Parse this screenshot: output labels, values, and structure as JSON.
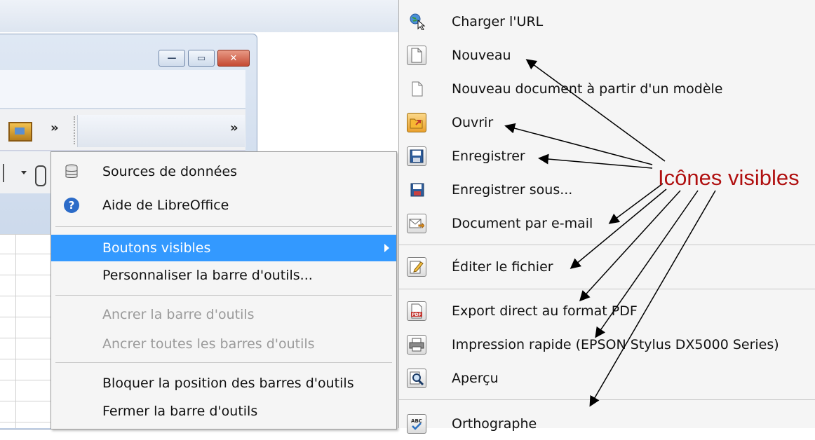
{
  "window": {
    "toolbar_more": "»",
    "toolbar_more2": "»",
    "min_symbol": "—",
    "max_symbol": "▭",
    "close_symbol": "✕"
  },
  "context_menu": {
    "items": [
      {
        "label": "Sources de données",
        "accel": "S",
        "icon": "database-icon",
        "disabled": false
      },
      {
        "label": "Aide de LibreOffice",
        "accel": "d",
        "icon": "help-icon",
        "disabled": false
      },
      {
        "label": "Boutons visibles",
        "accel": "v",
        "icon": "",
        "disabled": false,
        "highlighted": true,
        "submenu": true
      },
      {
        "label": "Personnaliser la barre d'outils...",
        "accel": "P",
        "icon": "",
        "disabled": false
      },
      {
        "label": "Ancrer la barre d'outils",
        "accel": "A",
        "icon": "",
        "disabled": true
      },
      {
        "label": "Ancrer toutes les barres d'outils",
        "accel": "t",
        "icon": "",
        "disabled": true
      },
      {
        "label": "Bloquer la position des barres d'outils",
        "accel": "B",
        "icon": "",
        "disabled": false
      },
      {
        "label": "Fermer la barre d'outils",
        "accel": "t",
        "icon": "",
        "disabled": false
      }
    ]
  },
  "submenu": {
    "items": [
      {
        "label": "Charger l'URL",
        "icon": "load-url-icon"
      },
      {
        "label": "Nouveau",
        "icon": "new-document-icon"
      },
      {
        "label": "Nouveau document à partir d'un modèle",
        "icon": "template-document-icon"
      },
      {
        "label": "Ouvrir",
        "icon": "open-folder-icon"
      },
      {
        "label": "Enregistrer",
        "icon": "save-icon"
      },
      {
        "label": "Enregistrer sous...",
        "icon": "save-as-icon"
      },
      {
        "label": "Document par e-mail",
        "icon": "email-document-icon"
      },
      {
        "label": "Éditer le fichier",
        "icon": "edit-file-icon"
      },
      {
        "label": "Export direct au format PDF",
        "icon": "pdf-icon"
      },
      {
        "label": "Impression rapide (EPSON Stylus DX5000 Series)",
        "icon": "print-icon"
      },
      {
        "label": "Aperçu",
        "icon": "preview-icon"
      },
      {
        "label": "Orthographe",
        "icon": "spelling-icon"
      }
    ]
  },
  "annotation": {
    "label": "Icônes visibles",
    "color": "#b01010"
  },
  "colors": {
    "highlight": "#3399ff",
    "disabled_text": "#9a9a9a"
  }
}
